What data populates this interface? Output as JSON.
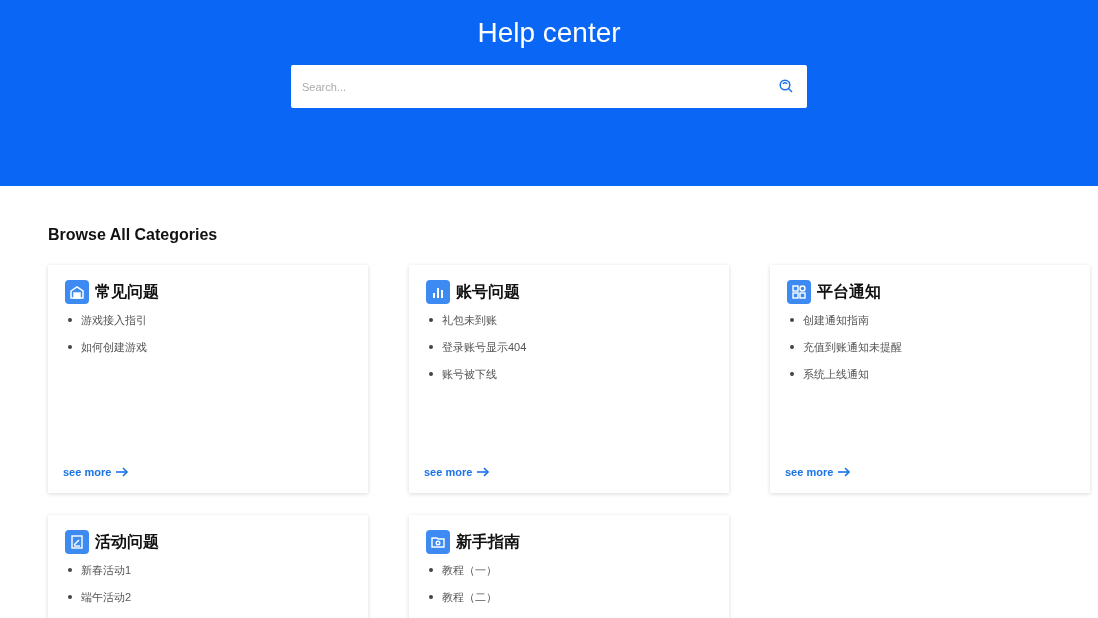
{
  "header": {
    "title": "Help center",
    "search": {
      "placeholder": "Search..."
    }
  },
  "section_title": "Browse All Categories",
  "categories": [
    {
      "kind": "house",
      "title": "常见问题",
      "items": [
        "游戏接入指引",
        "如何创建游戏"
      ],
      "link": "see more"
    },
    {
      "kind": "bars",
      "title": "账号问题",
      "items": [
        "礼包未到账",
        "登录账号显示404",
        "账号被下线"
      ],
      "link": "see more"
    },
    {
      "kind": "shapes",
      "title": "平台通知",
      "items": [
        "创建通知指南",
        "充值到账通知未提醒",
        "系统上线通知"
      ],
      "link": "see more"
    },
    {
      "kind": "clipboard",
      "title": "活动问题",
      "items": [
        "新春活动1",
        "端午活动2"
      ]
    },
    {
      "kind": "folder",
      "title": "新手指南",
      "items": [
        "教程（一）",
        "教程（二）"
      ]
    }
  ]
}
